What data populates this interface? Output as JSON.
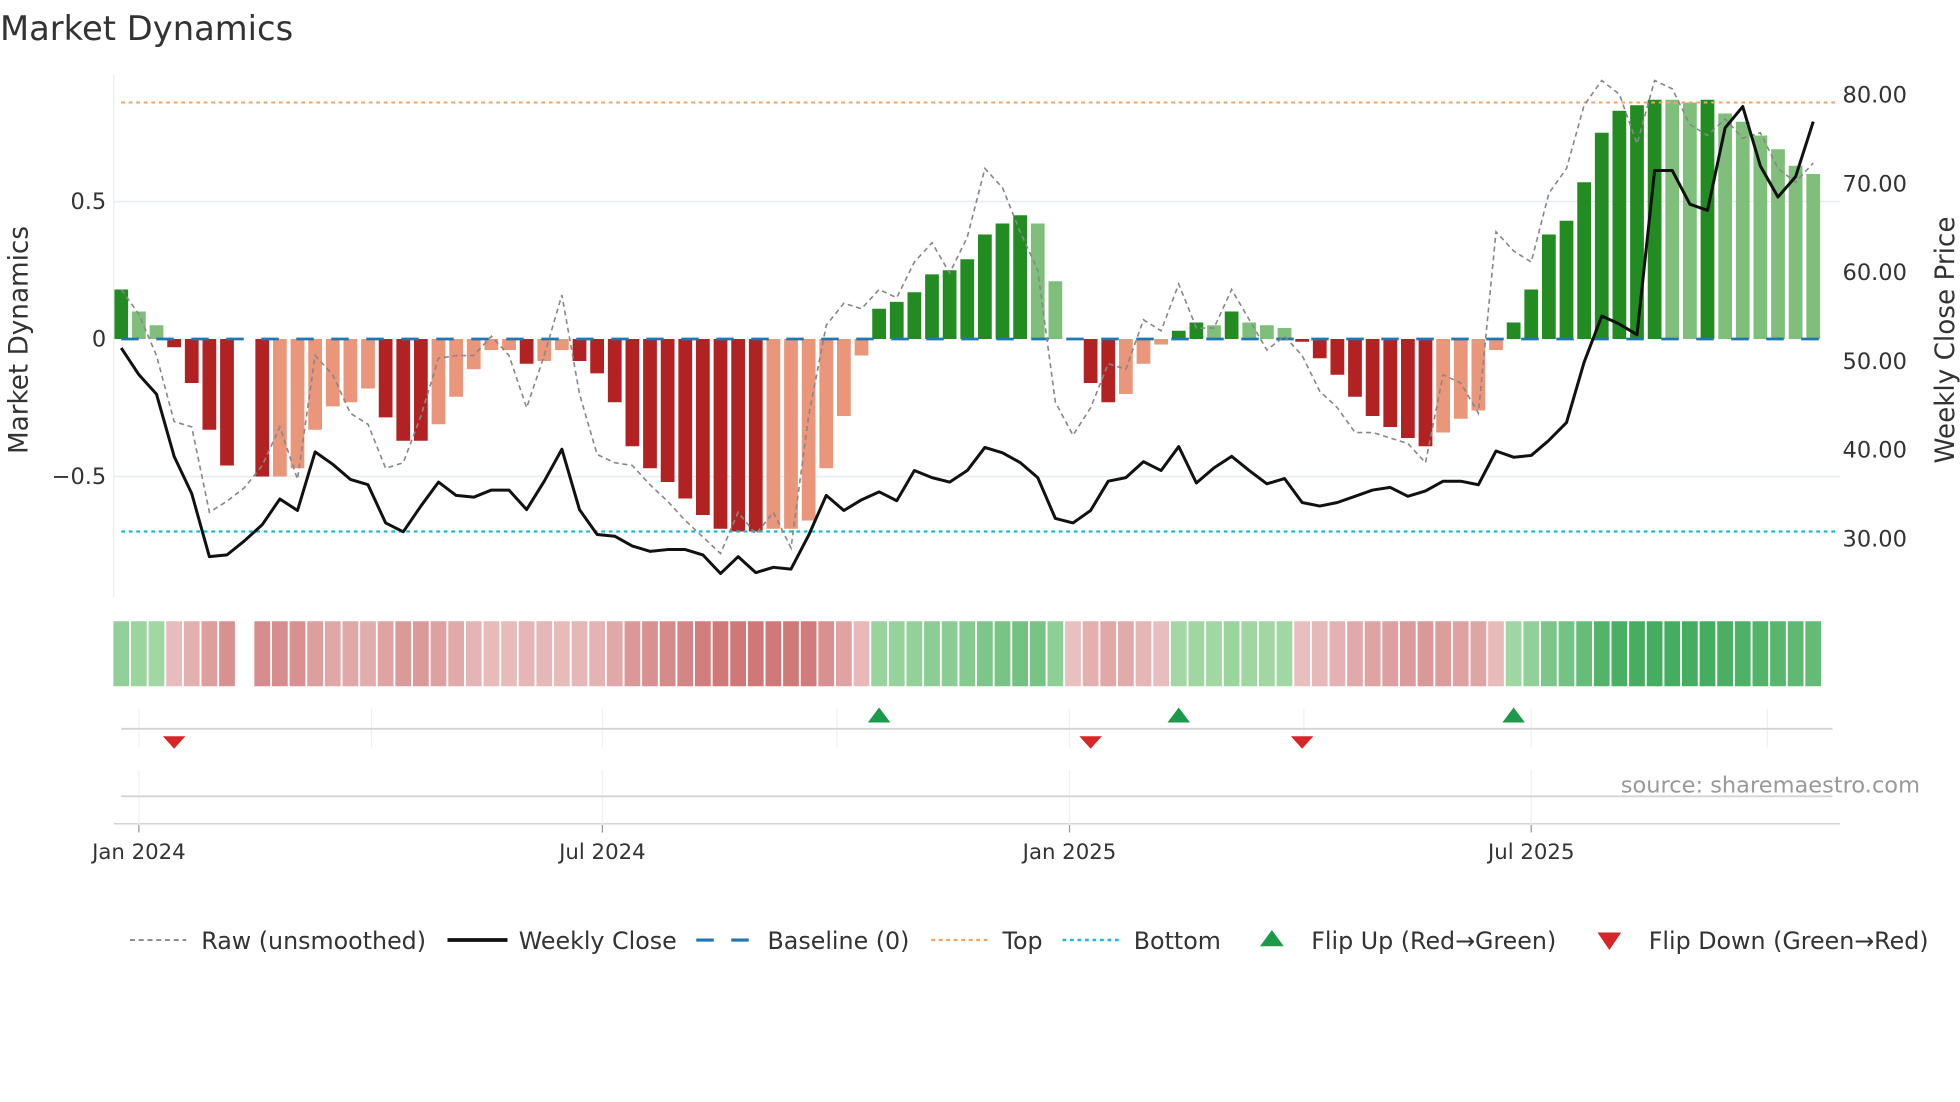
{
  "chart_data": {
    "type": "bar",
    "title": "Market Dynamics",
    "ylabel": "Market Dynamics",
    "y2label": "Weekly Close Price",
    "ylim": [
      -0.94,
      0.96
    ],
    "y2lim": [
      23.4,
      82.25
    ],
    "yticks": [
      {
        "v": 0.5,
        "label": "0.5"
      },
      {
        "v": 0,
        "label": "0"
      },
      {
        "v": -0.5,
        "label": "−0.5"
      }
    ],
    "y2ticks": [
      {
        "v": 80,
        "label": "80.00"
      },
      {
        "v": 70,
        "label": "70.00"
      },
      {
        "v": 60,
        "label": "60.00"
      },
      {
        "v": 50,
        "label": "50.00"
      },
      {
        "v": 40,
        "label": "40.00"
      },
      {
        "v": 30,
        "label": "30.00"
      }
    ],
    "xticks": [
      {
        "week": 1.0,
        "label": "Jan 2024"
      },
      {
        "week": 27.3,
        "label": "Jul 2024"
      },
      {
        "week": 53.8,
        "label": "Jan 2025"
      },
      {
        "week": 80.0,
        "label": "Jul 2025"
      }
    ],
    "minor_xgrid_weeks": [
      14.2,
      40.6,
      67.1,
      93.4
    ],
    "top": 0.86,
    "bottom": -0.7,
    "baseline": 0,
    "bars": [
      0.18,
      0.1,
      0.05,
      -0.03,
      -0.16,
      -0.33,
      -0.46,
      null,
      -0.5,
      -0.5,
      -0.47,
      -0.33,
      -0.245,
      -0.23,
      -0.18,
      -0.285,
      -0.37,
      -0.37,
      -0.31,
      -0.21,
      -0.11,
      -0.04,
      -0.04,
      -0.09,
      -0.08,
      -0.04,
      -0.08,
      -0.125,
      -0.23,
      -0.39,
      -0.47,
      -0.52,
      -0.58,
      -0.64,
      -0.69,
      -0.7,
      -0.7,
      -0.69,
      -0.69,
      -0.66,
      -0.47,
      -0.28,
      -0.06,
      0.11,
      0.135,
      0.17,
      0.235,
      0.25,
      0.29,
      0.38,
      0.42,
      0.45,
      0.42,
      0.21,
      0.0,
      -0.16,
      -0.23,
      -0.2,
      -0.09,
      -0.02,
      0.03,
      0.06,
      0.05,
      0.1,
      0.06,
      0.05,
      0.04,
      -0.01,
      -0.07,
      -0.13,
      -0.21,
      -0.28,
      -0.32,
      -0.36,
      -0.39,
      -0.34,
      -0.29,
      -0.26,
      -0.04,
      0.06,
      0.18,
      0.38,
      0.43,
      0.57,
      0.75,
      0.83,
      0.85,
      0.87,
      0.87,
      0.86,
      0.87,
      0.82,
      0.79,
      0.74,
      0.69,
      0.63,
      0.6
    ],
    "bar_strong": [
      1,
      0,
      0,
      1,
      1,
      1,
      1,
      0,
      1,
      0,
      0,
      0,
      0,
      0,
      0,
      1,
      1,
      1,
      0,
      0,
      0,
      0,
      0,
      1,
      0,
      0,
      1,
      1,
      1,
      1,
      1,
      1,
      1,
      1,
      1,
      1,
      1,
      0,
      0,
      0,
      0,
      0,
      0,
      1,
      1,
      1,
      1,
      1,
      1,
      1,
      1,
      1,
      0,
      0,
      0,
      1,
      1,
      0,
      0,
      0,
      1,
      1,
      0,
      1,
      0,
      0,
      0,
      1,
      1,
      1,
      1,
      1,
      1,
      1,
      1,
      0,
      0,
      0,
      0,
      1,
      1,
      1,
      1,
      1,
      1,
      1,
      1,
      1,
      0,
      0,
      1,
      0,
      0,
      0,
      0,
      0,
      0
    ],
    "raw": [
      0.18,
      0.09,
      -0.06,
      -0.3,
      -0.32,
      -0.63,
      -0.59,
      -0.54,
      -0.46,
      -0.32,
      -0.51,
      -0.06,
      -0.13,
      -0.27,
      -0.31,
      -0.47,
      -0.45,
      -0.28,
      -0.07,
      -0.06,
      -0.06,
      0.01,
      -0.06,
      -0.25,
      -0.06,
      0.16,
      -0.2,
      -0.42,
      -0.45,
      -0.46,
      -0.53,
      -0.59,
      -0.66,
      -0.72,
      -0.78,
      -0.63,
      -0.71,
      -0.63,
      -0.76,
      -0.28,
      0.05,
      0.13,
      0.11,
      0.18,
      0.15,
      0.28,
      0.35,
      0.24,
      0.37,
      0.62,
      0.55,
      0.39,
      0.25,
      -0.23,
      -0.35,
      -0.25,
      -0.09,
      -0.11,
      0.07,
      0.03,
      0.2,
      0.04,
      0.04,
      0.18,
      0.07,
      -0.04,
      0.01,
      -0.06,
      -0.19,
      -0.25,
      -0.34,
      -0.34,
      -0.36,
      -0.38,
      -0.45,
      -0.13,
      -0.16,
      -0.27,
      0.39,
      0.32,
      0.28,
      0.53,
      0.62,
      0.85,
      0.94,
      0.89,
      0.71,
      0.94,
      0.91,
      0.78,
      0.74,
      0.8,
      0.73,
      0.75,
      0.62,
      0.57,
      0.64
    ],
    "close": [
      51.5,
      48.5,
      46.3,
      39.3,
      35.1,
      28.0,
      28.2,
      29.8,
      31.6,
      34.5,
      33.2,
      39.8,
      38.4,
      36.7,
      36.1,
      31.8,
      30.8,
      33.7,
      36.4,
      34.9,
      34.7,
      35.5,
      35.5,
      33.3,
      36.5,
      40.1,
      33.3,
      30.5,
      30.3,
      29.2,
      28.6,
      28.8,
      28.8,
      28.2,
      26.1,
      28.0,
      26.2,
      26.8,
      26.6,
      30.4,
      34.9,
      33.2,
      34.4,
      35.3,
      34.3,
      37.7,
      36.9,
      36.4,
      37.7,
      40.3,
      39.7,
      38.6,
      36.9,
      32.3,
      31.8,
      33.2,
      36.5,
      36.9,
      38.7,
      37.7,
      40.4,
      36.3,
      38.0,
      39.3,
      37.7,
      36.2,
      36.8,
      34.1,
      33.7,
      34.1,
      34.8,
      35.5,
      35.8,
      34.8,
      35.4,
      36.5,
      36.5,
      36.1,
      39.9,
      39.2,
      39.4,
      41.1,
      43.1,
      49.9,
      55.1,
      54.2,
      53.0,
      71.5,
      71.5,
      67.7,
      67.0,
      76.3,
      78.7,
      72.0,
      68.5,
      70.8,
      77.0
    ],
    "flip_up_weeks": [
      43,
      60,
      79
    ],
    "flip_down_weeks": [
      3,
      55,
      67
    ],
    "colors": {
      "strong_green": "#228b22",
      "weak_green": "#7fbf7b",
      "strong_red": "#b22222",
      "weak_red": "#e9967a",
      "raw": "#888888",
      "close": "#111111",
      "baseline": "#1f77b4",
      "top": "#f4a460",
      "bottom": "#17becf",
      "flip_up": "#1a9a4a",
      "flip_down": "#d62728"
    },
    "legend": {
      "placement": "bottom",
      "items": [
        {
          "key": "raw",
          "label": "Raw (unsmoothed)"
        },
        {
          "key": "close",
          "label": "Weekly Close"
        },
        {
          "key": "baseline",
          "label": "Baseline (0)"
        },
        {
          "key": "top",
          "label": "Top"
        },
        {
          "key": "bottom",
          "label": "Bottom"
        },
        {
          "key": "flip_up",
          "label": "Flip Up (Red→Green)"
        },
        {
          "key": "flip_down",
          "label": "Flip Down (Green→Red)"
        }
      ]
    },
    "source": "source: sharemaestro.com"
  }
}
